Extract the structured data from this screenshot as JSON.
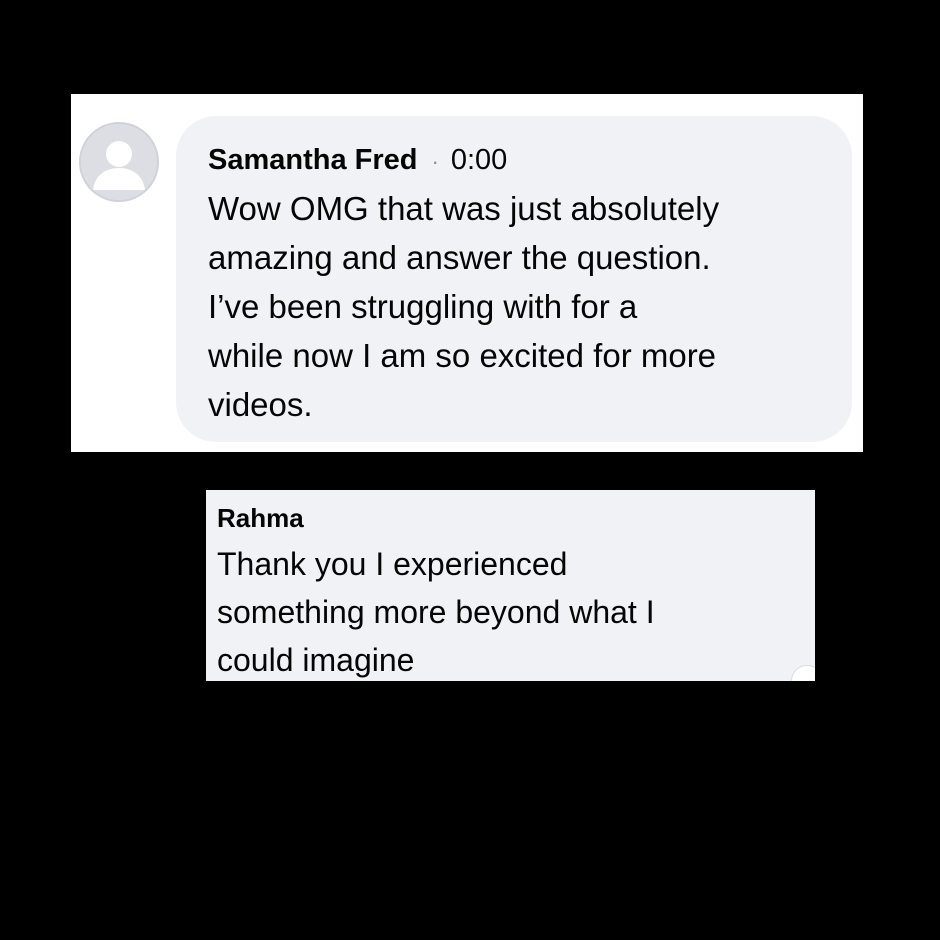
{
  "comments": [
    {
      "author": "Samantha Fred",
      "separator": "·",
      "timestamp": "0:00",
      "lines": [
        "Wow OMG that was just absolutely",
        "amazing and answer the question.",
        "I’ve been struggling with for a",
        "while now I am so excited for more",
        "videos."
      ],
      "avatar_icon": "default-user-avatar-icon"
    },
    {
      "author": "Rahma",
      "lines": [
        "Thank you I experienced",
        "something more beyond what I",
        "could imagine"
      ]
    }
  ],
  "colors": {
    "background": "#000000",
    "card": "#ffffff",
    "bubble": "#f0f2f5",
    "text": "#050505",
    "avatar": "#dcdee3"
  }
}
